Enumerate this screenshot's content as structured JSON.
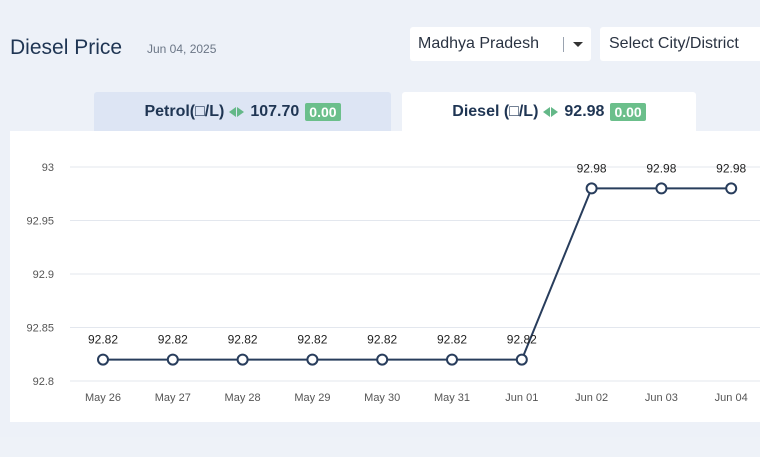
{
  "header": {
    "title": "Diesel Price",
    "date": "Jun 04, 2025"
  },
  "filters": {
    "state": "Madhya Pradesh",
    "city": "Select City/District"
  },
  "tabs": [
    {
      "name": "Petrol(□/L)",
      "price": "107.70",
      "change": "0.00",
      "active": false
    },
    {
      "name": "Diesel (□/L)",
      "price": "92.98",
      "change": "0.00",
      "active": true
    }
  ],
  "colors": {
    "accent": "#1f3553",
    "line": "#283d5c",
    "badge": "#6bbf8b",
    "tab_inactive": "#dde5f4"
  },
  "chart_data": {
    "type": "line",
    "categories": [
      "May 26",
      "May 27",
      "May 28",
      "May 29",
      "May 30",
      "May 31",
      "Jun 01",
      "Jun 02",
      "Jun 03",
      "Jun 04"
    ],
    "values": [
      92.82,
      92.82,
      92.82,
      92.82,
      92.82,
      92.82,
      92.82,
      92.98,
      92.98,
      92.98
    ],
    "data_labels": [
      "92.82",
      "92.82",
      "92.82",
      "92.82",
      "92.82",
      "92.82",
      "92.82",
      "92.98",
      "92.98",
      "92.98"
    ],
    "y_ticks": [
      "92.8",
      "92.85",
      "92.9",
      "92.95",
      "93"
    ],
    "ylim": [
      92.8,
      93.0
    ],
    "grid": true,
    "title": "",
    "xlabel": "",
    "ylabel": ""
  }
}
